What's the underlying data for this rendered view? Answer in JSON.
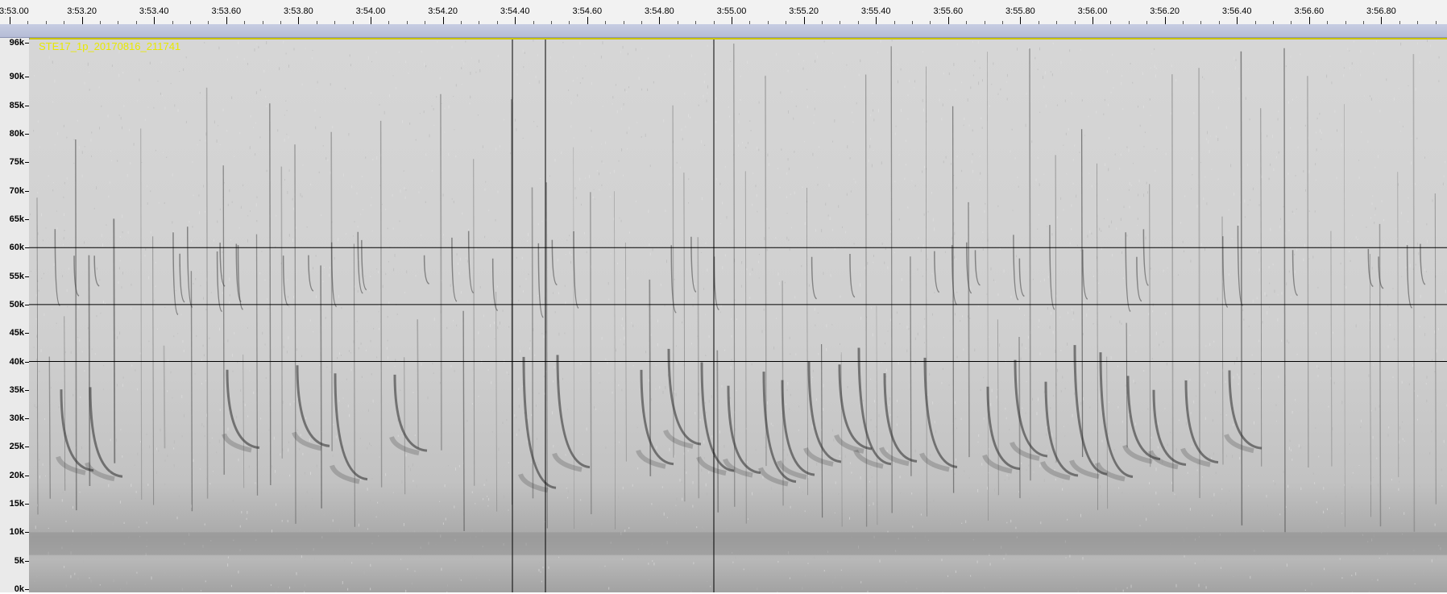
{
  "time_ruler": {
    "labels": [
      "3:53.00",
      "3:53.20",
      "3:53.40",
      "3:53.60",
      "3:53.80",
      "3:54.00",
      "3:54.20",
      "3:54.40",
      "3:54.60",
      "3:54.80",
      "3:55.00",
      "3:55.20",
      "3:55.40",
      "3:55.60",
      "3:55.80",
      "3:56.00",
      "3:56.20",
      "3:56.40",
      "3:56.60",
      "3:56.80"
    ]
  },
  "freq_axis": {
    "labels": [
      "96k",
      "90k",
      "85k",
      "80k",
      "75k",
      "70k",
      "65k",
      "60k",
      "55k",
      "50k",
      "45k",
      "40k",
      "35k",
      "30k",
      "25k",
      "20k",
      "15k",
      "10k",
      "5k",
      "0k"
    ]
  },
  "track": {
    "name": "STE17_1p_20170816_211741"
  },
  "colors": {
    "track_name": "#e8e800",
    "spectrogram_bg": "#d2d2d2",
    "timeline_bar": "#bcc3da",
    "track_border": "#c9c400"
  }
}
